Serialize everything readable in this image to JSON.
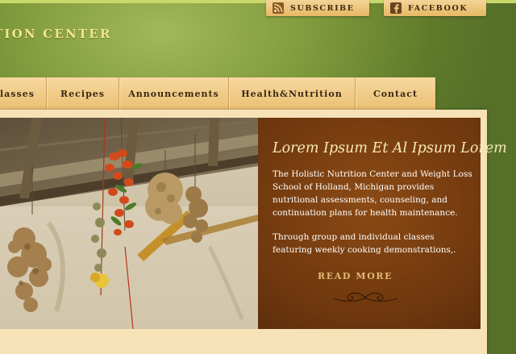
{
  "header": {
    "site_title": "tion Center",
    "social": {
      "subscribe_label": "Subscribe",
      "facebook_label": "Facebook",
      "subscribe_icon": "rss-icon",
      "facebook_icon": "facebook-icon"
    }
  },
  "nav": {
    "items": [
      {
        "label": "lasses"
      },
      {
        "label": "Recipes"
      },
      {
        "label": "Announcements"
      },
      {
        "label": "Health&Nutrition"
      },
      {
        "label": "Contact"
      }
    ]
  },
  "feature": {
    "title": "Lorem Ipsum Et Al Ipsum Lorem",
    "paragraph1": "The Holistic Nutrition Center and Weight Loss School of Holland, Michigan provides nutritional assessments, counseling, and continuation plans for health maintenance.",
    "paragraph2": "Through group and individual classes featuring weekly cooking demonstrations,.",
    "read_more_label": "Read More"
  },
  "colors": {
    "background_green": "#7f9a3c",
    "tab_gold": "#ebbf72",
    "feature_brown": "#6e370e",
    "title_yellow": "#f4e58a"
  }
}
